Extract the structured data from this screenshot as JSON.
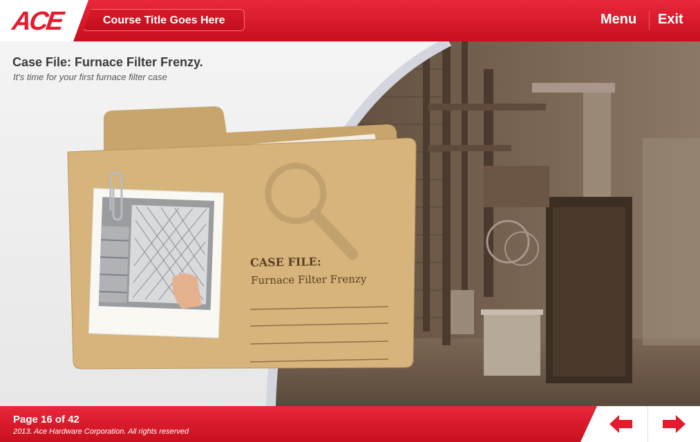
{
  "header": {
    "logo_text": "ACE",
    "course_title": "Course Title Goes Here",
    "menu_label": "Menu",
    "exit_label": "Exit"
  },
  "content": {
    "title": "Case File: Furnace Filter Frenzy.",
    "subtitle": "It's time for your first furnace filter case",
    "folder": {
      "heading": "CASE FILE:",
      "case_name": "Furnace Filter Frenzy"
    }
  },
  "footer": {
    "page_indicator": "Page 16 of 42",
    "copyright": "2013. Ace Hardware Corporation. All rights reserved",
    "prev_icon": "arrow-left-icon",
    "next_icon": "arrow-right-icon"
  },
  "colors": {
    "brand_red": "#e31b2c",
    "folder_tan": "#c9a870"
  }
}
